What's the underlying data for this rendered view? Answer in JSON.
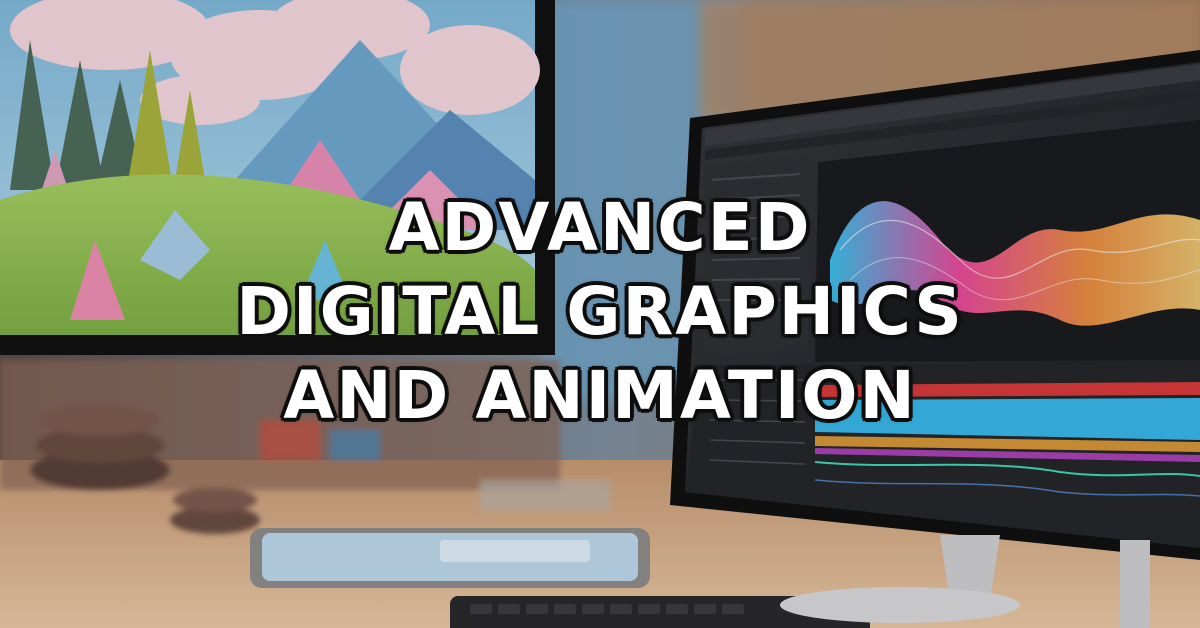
{
  "headline": {
    "line1": "ADVANCED",
    "line2": "DIGITAL GRAPHICS",
    "line3": "AND ANIMATION"
  },
  "colors": {
    "text": "#ffffff",
    "text_outline": "#111111",
    "sky": "#8fc3e0",
    "cloud": "#f3d6dc",
    "hill": "#94c25a",
    "desk": "#d9b48e",
    "monitor_bezel": "#141414",
    "editor_bg": "#2b2d31"
  },
  "icons": {
    "background_scene": "desk-with-monitors-photo",
    "left_monitor": "monitor-landscape-illustration",
    "right_monitor": "monitor-animation-software"
  }
}
